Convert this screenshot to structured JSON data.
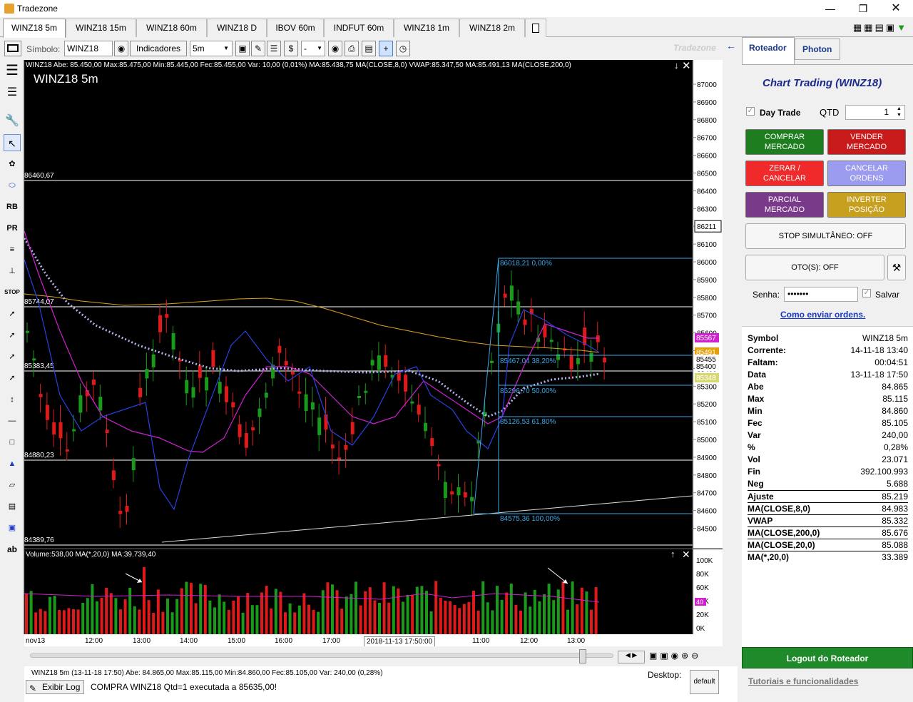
{
  "window": {
    "title": "Tradezone"
  },
  "tabs": [
    {
      "label": "WINZ18 5m",
      "active": true
    },
    {
      "label": "WINZ18 15m"
    },
    {
      "label": "WINZ18 60m"
    },
    {
      "label": "WINZ18 D"
    },
    {
      "label": "IBOV 60m"
    },
    {
      "label": "INDFUT 60m"
    },
    {
      "label": "WINZ18 1m"
    },
    {
      "label": "WINZ18 2m"
    }
  ],
  "toolbar": {
    "symbol_label": "Símbolo:",
    "symbol_value": "WINZ18",
    "indicators_label": "Indicadores",
    "period_value": "5m",
    "dash_value": "-",
    "watermark": "Tradezone"
  },
  "chart": {
    "header": "WINZ18 Abe: 85.450,00  Max:85.475,00  Min:85.445,00  Fec:85.455,00  Var: 10,00 (0,01%)  MA:85.438,75 MA(CLOSE,8,0) VWAP:85.347,50 MA:85.491,13 MA(CLOSE,200,0)",
    "title": "WINZ18 5m",
    "hlines": [
      "86460,67",
      "85744,07",
      "85383,45",
      "84880,23",
      "84389,76"
    ],
    "fib": [
      "86018,21 0,00%",
      "85467,04 38,20%",
      "85296,70 50,00%",
      "85126,53 61,80%",
      "84575,36 100,00%"
    ],
    "price_ticks": [
      "87000",
      "86900",
      "86800",
      "86700",
      "86600",
      "86500",
      "86400",
      "86300",
      "86211",
      "86100",
      "86000",
      "85900",
      "85800",
      "85700",
      "85600",
      "85500",
      "85400",
      "85300",
      "85200",
      "85100",
      "85000",
      "84900",
      "84800",
      "84700",
      "84600",
      "84500"
    ],
    "price_tags": [
      {
        "text": "85567",
        "color": "#d020d0"
      },
      {
        "text": "85491",
        "color": "#e8a000"
      },
      {
        "text": "85455",
        "color": "#ffffff"
      },
      {
        "text": "85400",
        "color": "#ffffff"
      },
      {
        "text": "85348",
        "color": "#d8d870"
      }
    ],
    "volume_header": "Volume:538,00 MA(*,20,0) MA:39.739,40",
    "volume_ticks": [
      "100K",
      "80K",
      "60K",
      "40K",
      "20K",
      "0K",
      "x1K"
    ],
    "volume_tag": "40",
    "time_labels": [
      "nov13",
      "12:00",
      "13:00",
      "14:00",
      "15:00",
      "16:00",
      "17:00",
      "11:00",
      "12:00",
      "13:00"
    ],
    "cursor_time": "2018-11-13 17:50:00"
  },
  "status": {
    "line": "WINZ18 5m  (13-11-18 17:50)  Abe: 84.865,00  Max:85.115,00  Min:84.860,00  Fec:85.105,00  Var: 240,00 (0,28%)",
    "log_button": "Exibir Log",
    "message": "COMPRA  WINZ18  Qtd=1 executada a 85635,00!",
    "desktop_label": "Desktop:",
    "desktop_button": "default"
  },
  "right": {
    "tabs": [
      "Roteador",
      "Photon"
    ],
    "heading": "Chart Trading  (WINZ18)",
    "daytrade_label": "Day Trade",
    "qtd_label": "QTD",
    "qtd_value": "1",
    "buttons": [
      {
        "l1": "COMPRAR",
        "l2": "MERCADO",
        "color": "#1e7d1e"
      },
      {
        "l1": "VENDER",
        "l2": "MERCADO",
        "color": "#c81a1a"
      },
      {
        "l1": "ZERAR /",
        "l2": "CANCELAR",
        "color": "#f02a2a"
      },
      {
        "l1": "CANCELAR",
        "l2": "ORDENS",
        "color": "#9b9bf0"
      },
      {
        "l1": "PARCIAL",
        "l2": "MERCADO",
        "color": "#7a3a8a"
      },
      {
        "l1": "INVERTER",
        "l2": "POSIÇÃO",
        "color": "#c8a020"
      }
    ],
    "stop_label": "STOP SIMULTÂNEO: OFF",
    "oto_label": "OTO(S): OFF",
    "senha_label": "Senha:",
    "senha_value": "•••••••",
    "salvar_label": "Salvar",
    "como_link": "Como enviar ordens.",
    "info": [
      {
        "k": "Symbol",
        "v": "WINZ18 5m"
      },
      {
        "k": "Corrente:",
        "v": "14-11-18 13:40"
      },
      {
        "k": "Faltam:",
        "v": "00:04:51"
      },
      {
        "k": "Data",
        "v": "13-11-18 17:50"
      },
      {
        "k": "Abe",
        "v": "84.865"
      },
      {
        "k": "Max",
        "v": "85.115"
      },
      {
        "k": "Min",
        "v": "84.860"
      },
      {
        "k": "Fec",
        "v": "85.105"
      },
      {
        "k": "Var",
        "v": "240,00"
      },
      {
        "k": "%",
        "v": "0,28%"
      },
      {
        "k": "Vol",
        "v": "23.071"
      },
      {
        "k": "Fin",
        "v": "392.100.993"
      },
      {
        "k": "Neg",
        "v": "5.688"
      },
      {
        "k": "Ajuste",
        "v": "85.219"
      },
      {
        "k": "MA(CLOSE,8,0)",
        "v": "84.983"
      },
      {
        "k": "VWAP",
        "v": "85.332"
      },
      {
        "k": "MA(CLOSE,200,0)",
        "v": "85.676"
      },
      {
        "k": "MA(CLOSE,20,0)",
        "v": "85.088"
      },
      {
        "k": "MA(*,20,0)",
        "v": "33.389"
      }
    ],
    "logout_label": "Logout do Roteador",
    "tutorials_label": "Tutoriais e funcionalidades"
  }
}
